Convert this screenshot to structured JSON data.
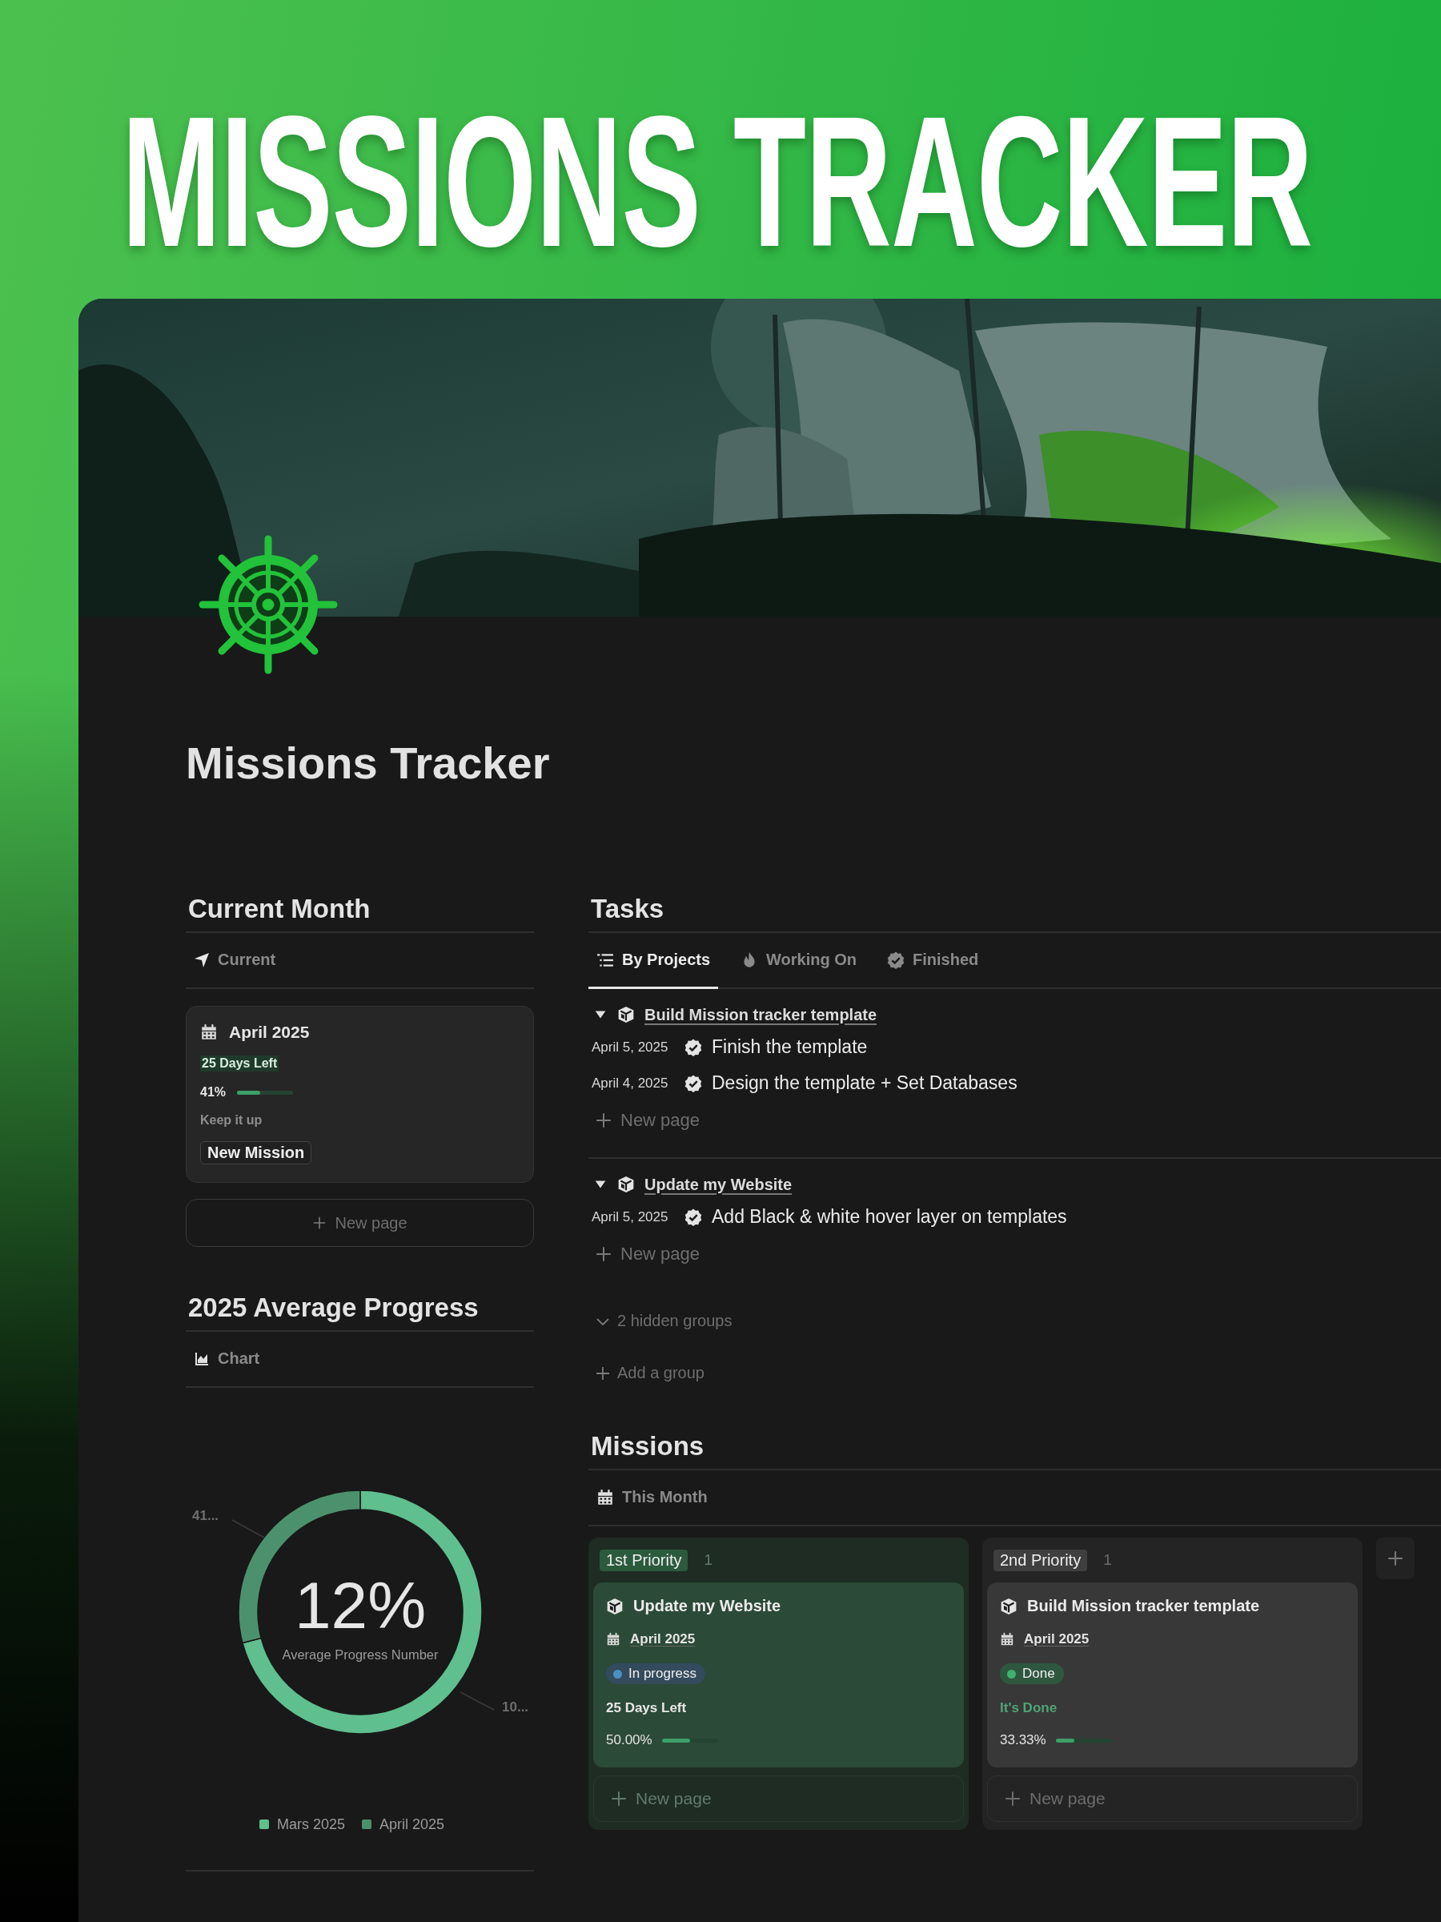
{
  "banner": {
    "title": "MISSIONS TRACKER"
  },
  "page": {
    "title": "Missions Tracker"
  },
  "current_month": {
    "heading": "Current Month",
    "views": [
      {
        "label": "Current"
      }
    ],
    "card": {
      "month": "April 2025",
      "days_left": "25 Days Left",
      "percent": "41%",
      "level": 0.41,
      "message": "Keep it up",
      "button": "New Mission"
    },
    "new_page": "New page"
  },
  "average_progress": {
    "heading": "2025 Average Progress",
    "views": [
      {
        "label": "Chart"
      }
    ],
    "center_value": "12%",
    "center_label": "Average Progress Number",
    "chart_data": {
      "type": "donut",
      "legend": "bottom",
      "categories": [
        "Mars 2025",
        "April 2025"
      ],
      "series": [
        {
          "color": "#5fbf8e",
          "values": [
            70.92,
            29.08
          ]
        }
      ],
      "value_labels": [
        "10...",
        "41..."
      ]
    }
  },
  "tasks": {
    "heading": "Tasks",
    "views": [
      {
        "label": "By Projects",
        "selected": true
      },
      {
        "label": "Working On",
        "selected": false
      },
      {
        "label": "Finished",
        "selected": false
      }
    ],
    "groups": [
      {
        "title": "Build Mission tracker template",
        "expanded": true,
        "items": [
          {
            "date": "April 5, 2025",
            "title": "Finish the template"
          },
          {
            "date": "April 4, 2025",
            "title": "Design the template + Set Databases"
          }
        ],
        "new_page": "New page"
      },
      {
        "title": "Update my Website",
        "expanded": true,
        "items": [
          {
            "date": "April 5, 2025",
            "title": "Add Black & white hover layer on templates"
          }
        ],
        "new_page": "New page"
      }
    ],
    "hidden_groups": "2 hidden groups",
    "add_group": "Add a group"
  },
  "missions": {
    "heading": "Missions",
    "views": [
      {
        "label": "This Month"
      }
    ],
    "columns": [
      {
        "name": "1st Priority",
        "count": "1",
        "color": "#2b5a3d",
        "cards": [
          {
            "title": "Update my Website",
            "month": "April 2025",
            "status": {
              "label": "In progress",
              "color": "#4a90c2"
            },
            "note": {
              "kind": "countdown",
              "text": "25 Days Left"
            },
            "percent": "50.00%",
            "level": 0.5
          }
        ],
        "new_page": "New page"
      },
      {
        "name": "2nd Priority",
        "count": "1",
        "color": "#3f3f3f",
        "cards": [
          {
            "title": "Build Mission tracker template",
            "month": "April 2025",
            "status": {
              "label": "Done",
              "color": "#3fb26f"
            },
            "note": {
              "kind": "done",
              "text": "It's Done"
            },
            "percent": "33.33%",
            "level": 0.3333
          }
        ],
        "new_page": "New page"
      }
    ]
  }
}
